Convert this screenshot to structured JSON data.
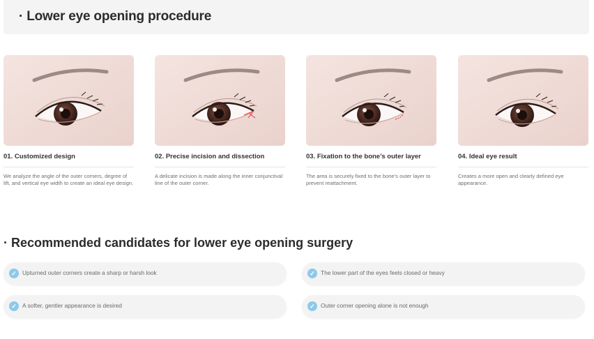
{
  "header": {
    "title": "· Lower eye opening procedure"
  },
  "steps": [
    {
      "title": "01. Customized design",
      "description": "We analyze the angle of the outer corners, degree of lift, and vertical eye width to create an ideal eye design."
    },
    {
      "title": "02. Precise incision and dissection",
      "description": "A delicate incision is made along the inner conjunctival line of the outer corner."
    },
    {
      "title": "03. Fixation to the bone’s outer layer",
      "description": "The area is securely fixed to the bone’s outer layer to prevent reattachment."
    },
    {
      "title": "04. Ideal eye result",
      "description": "Creates a more open and clearly defined eye appearance."
    }
  ],
  "candidates": {
    "title": "· Recommended candidates for lower eye opening surgery",
    "items": [
      "Upturned outer corners create a sharp or harsh look",
      "The lower part of the eyes feels closed or heavy",
      "A softer, gentler appearance is desired",
      "Outer corner opening alone is not enough"
    ]
  },
  "colors": {
    "accent": "#8ec9ea",
    "pill_bg": "#f3f3f3",
    "header_bg": "#f4f4f4",
    "incision": "#e8333a"
  },
  "icons": {
    "check": "check-circle-icon"
  }
}
